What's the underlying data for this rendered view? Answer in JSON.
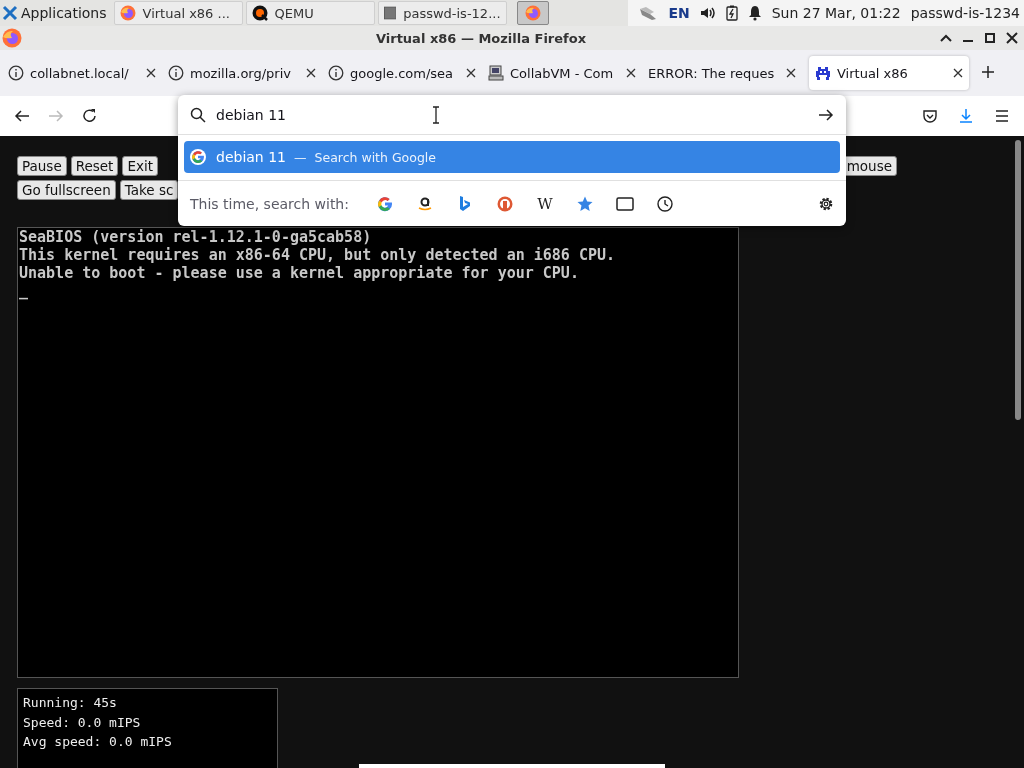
{
  "taskbar": {
    "apps_label": "Applications",
    "tasks": [
      {
        "label": "Virtual x86 ...",
        "kind": "firefox",
        "selected": false
      },
      {
        "label": "QEMU",
        "kind": "qemu",
        "selected": false
      },
      {
        "label": "passwd-is-12...",
        "kind": "terminal",
        "selected": false
      },
      {
        "kind": "firefox",
        "selected": true
      }
    ],
    "layout": "EN",
    "clock": "Sun 27 Mar, 01:22",
    "user": "passwd-is-1234"
  },
  "window": {
    "title": "Virtual x86 — Mozilla Firefox"
  },
  "tabs": [
    {
      "label": "collabnet.local/",
      "kind": "info",
      "selected": false
    },
    {
      "label": "mozilla.org/priv",
      "kind": "info",
      "selected": false
    },
    {
      "label": "google.com/sea",
      "kind": "info",
      "selected": false
    },
    {
      "label": "CollabVM - Com",
      "kind": "computer",
      "selected": false
    },
    {
      "label": "ERROR: The reques",
      "kind": "plain",
      "selected": false
    },
    {
      "label": "Virtual x86",
      "kind": "invader",
      "selected": true
    }
  ],
  "nav_buttons": [
    {
      "kind": "back",
      "disabled": false
    },
    {
      "kind": "forward",
      "disabled": true
    },
    {
      "kind": "reload",
      "disabled": false
    }
  ],
  "urlbar": {
    "value": "debian 11 ",
    "suggestion": {
      "query": "debian 11",
      "separator": "—",
      "action": "Search with Google",
      "selected": true
    },
    "engines_label": "This time, search with:",
    "engines": [
      {
        "kind": "google"
      },
      {
        "kind": "amazon"
      },
      {
        "kind": "bing"
      },
      {
        "kind": "duckduckgo"
      },
      {
        "kind": "wikipedia",
        "label": "W"
      },
      {
        "kind": "bookmarks"
      },
      {
        "kind": "tabs"
      },
      {
        "kind": "history"
      }
    ]
  },
  "emulator": {
    "button_rows": [
      [
        {
          "label": "Pause",
          "kind": "plain"
        },
        {
          "label": "Reset",
          "kind": "plain"
        },
        {
          "label": "Exit",
          "kind": "plain"
        },
        {
          "label": "mouse",
          "kind": "far"
        }
      ],
      [
        {
          "label": "Go fullscreen",
          "kind": "plain"
        },
        {
          "label": "Take sc",
          "kind": "plain"
        }
      ]
    ],
    "screen_lines": [
      "SeaBIOS (version rel-1.12.1-0-ga5cab58)",
      "This kernel requires an x86-64 CPU, but only detected an i686 CPU.",
      "Unable to boot - please use a kernel appropriate for your CPU.",
      "_"
    ],
    "stats": [
      "Running: 45s",
      "Speed: 0.0 mIPS",
      "Avg speed: 0.0 mIPS"
    ]
  }
}
